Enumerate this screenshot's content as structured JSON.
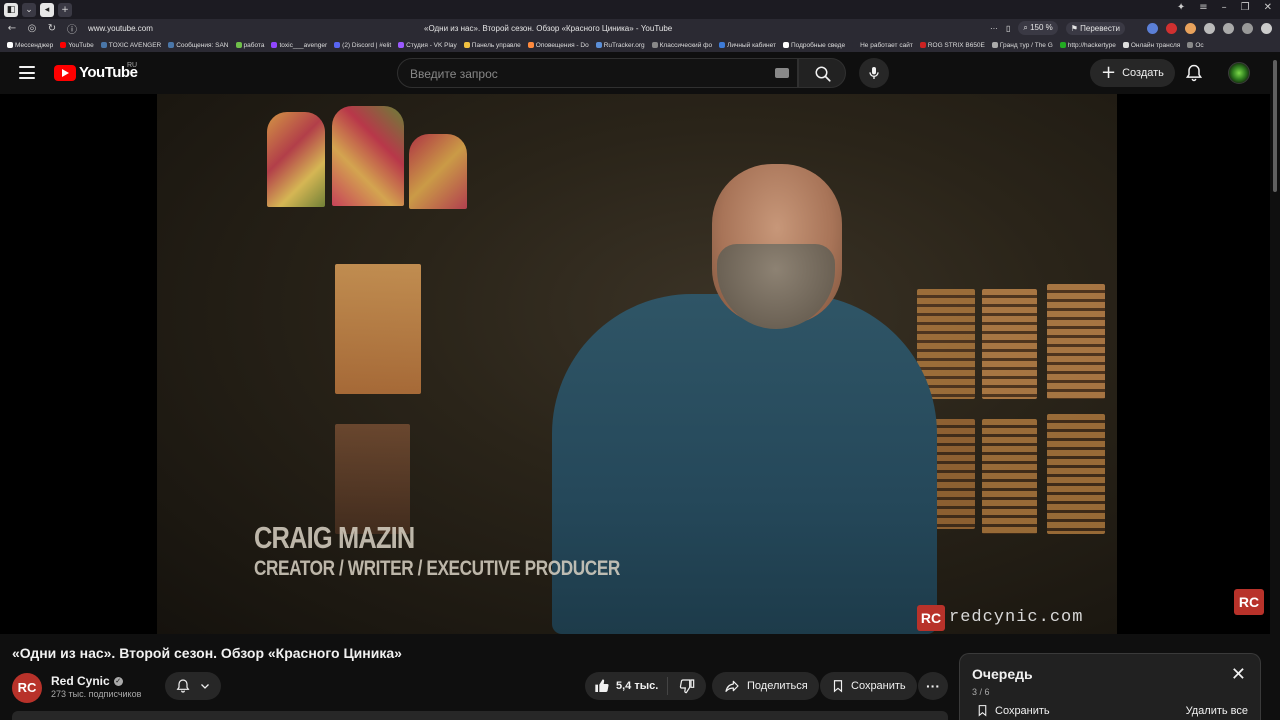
{
  "browser": {
    "url": "www.youtube.com",
    "page_title": "«Одни из нас». Второй сезон. Обзор «Красного Циника» - YouTube",
    "zoom": "150 %",
    "translate_label": "Перевести",
    "bookmarks": [
      {
        "label": "Мессенджер",
        "color": "#ffffff"
      },
      {
        "label": "YouTube",
        "color": "#ff0000"
      },
      {
        "label": "TOXIC AVENGER",
        "color": "#4a76a8"
      },
      {
        "label": "Сообщения: SAN",
        "color": "#4a76a8"
      },
      {
        "label": "работа",
        "color": "#6fbf4a"
      },
      {
        "label": "toxic___avenger",
        "color": "#9146ff"
      },
      {
        "label": "(2) Discord | #elit",
        "color": "#5865f2"
      },
      {
        "label": "Студия - VK Play",
        "color": "#9b59ff"
      },
      {
        "label": "Панель управле",
        "color": "#f0c040"
      },
      {
        "label": "Оповещения - Do",
        "color": "#ff8a3d"
      },
      {
        "label": "RuTracker.org",
        "color": "#5b8fd8"
      },
      {
        "label": "Классический фо",
        "color": "#888888"
      },
      {
        "label": "Личный кабинет",
        "color": "#3d7bd8"
      },
      {
        "label": "Подробные сведе",
        "color": "#ffffff"
      },
      {
        "label": "Не работает сайт",
        "color": "#2b2a33"
      },
      {
        "label": "ROG STRIX B650E",
        "color": "#cc2222"
      },
      {
        "label": "Гранд тур / The G",
        "color": "#aaaaaa"
      },
      {
        "label": "http://hackertype",
        "color": "#22aa22"
      },
      {
        "label": "Онлайн трансля",
        "color": "#dddddd"
      },
      {
        "label": "Ос",
        "color": "#888888"
      }
    ]
  },
  "header": {
    "logo_text": "YouTube",
    "region": "RU",
    "search_placeholder": "Введите запрос",
    "create_label": "Создать"
  },
  "video": {
    "lower_third_name": "CRAIG MAZIN",
    "lower_third_role": "CREATOR / WRITER / EXECUTIVE PRODUCER",
    "watermark_badge": "RC",
    "watermark_text": "redcynic.com",
    "corner_badge": "RC"
  },
  "meta": {
    "title": "«Одни из нас». Второй сезон. Обзор «Красного Циника»",
    "channel_name": "Red Cynic",
    "channel_initials": "RC",
    "subscribers": "273 тыс. подписчиков",
    "likes": "5,4 тыс.",
    "share_label": "Поделиться",
    "save_label": "Сохранить"
  },
  "queue": {
    "title": "Очередь",
    "count": "3 / 6",
    "save_label": "Сохранить",
    "clear_label": "Удалить все"
  }
}
